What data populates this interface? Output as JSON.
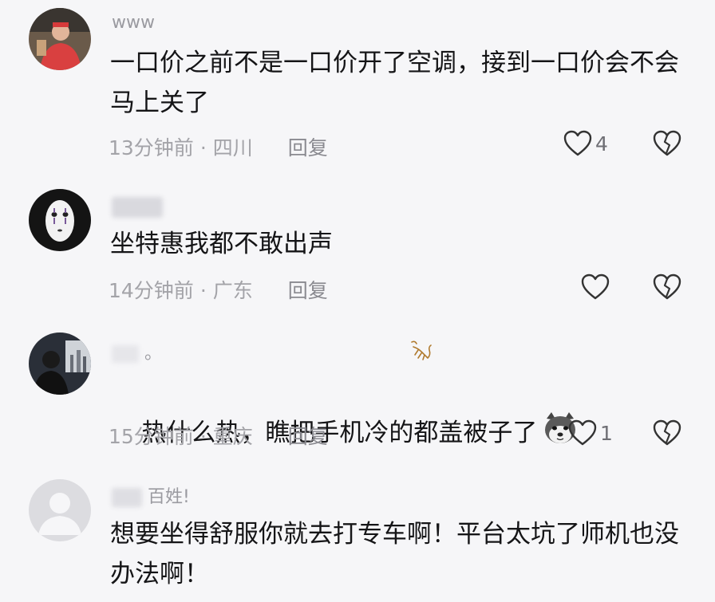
{
  "comments": [
    {
      "username": "www",
      "text": "一口价之前不是一口价开了空调，接到一口价会不会马上关了",
      "time": "13分钟前",
      "separator": "·",
      "location": "四川",
      "reply_label": "回复",
      "like_count": "4",
      "avatar_icon": "person-red-shirt-avatar"
    },
    {
      "username": "",
      "text": "坐特惠我都不敢出声",
      "time": "14分钟前",
      "separator": "·",
      "location": "广东",
      "reply_label": "回复",
      "like_count": "",
      "avatar_icon": "no-face-mask-avatar"
    },
    {
      "username": "。",
      "text": "热什么热，瞧把手机冷的都盖被子了",
      "time": "15分钟前",
      "separator": "·",
      "location": "重庆",
      "reply_label": "回复",
      "like_count": "1",
      "avatar_icon": "city-night-person-avatar",
      "emoji_icon": "husky-dog-emoji"
    },
    {
      "username": "百姓!",
      "text": "想要坐得舒服你就去打专车啊！平台太坑了师机也没办法啊！",
      "time": "",
      "separator": "",
      "location": "",
      "reply_label": "",
      "like_count": "",
      "avatar_icon": "default-gray-avatar"
    }
  ],
  "icons": {
    "like": "heart-outline-icon",
    "dislike": "broken-heart-icon"
  },
  "colors": {
    "background": "#f6f6f8",
    "text": "#151517",
    "meta": "#a3a3a8"
  }
}
